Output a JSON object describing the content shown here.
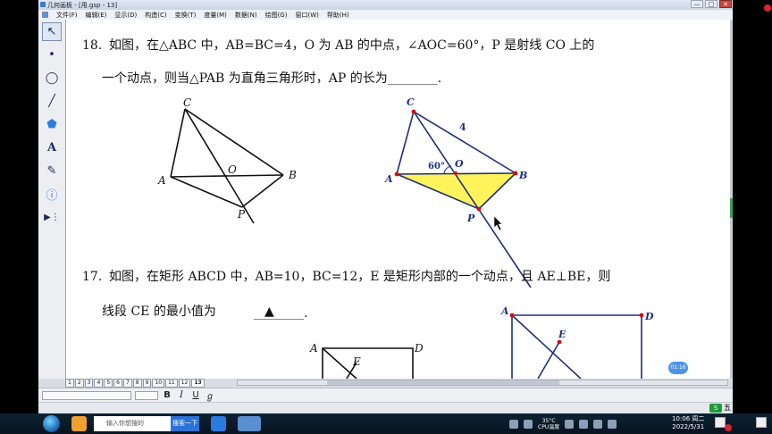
{
  "window": {
    "title": "几何画板 - [用.gsp - 13]",
    "min": "—",
    "max": "□",
    "close": "✕"
  },
  "menu": [
    "文件(F)",
    "编辑(E)",
    "显示(D)",
    "构造(C)",
    "变换(T)",
    "度量(M)",
    "数据(N)",
    "绘图(G)",
    "窗口(W)",
    "帮助(H)"
  ],
  "tools": [
    {
      "name": "select-arrow",
      "glyph": "↖"
    },
    {
      "name": "point",
      "glyph": "•"
    },
    {
      "name": "compass",
      "glyph": "◯"
    },
    {
      "name": "straightedge",
      "glyph": "╱"
    },
    {
      "name": "polygon",
      "glyph": "⬟"
    },
    {
      "name": "text",
      "glyph": "A"
    },
    {
      "name": "marker",
      "glyph": "✎"
    },
    {
      "name": "information",
      "glyph": "ⓘ"
    },
    {
      "name": "custom",
      "glyph": "▶⋮"
    }
  ],
  "q18": {
    "number": "18.",
    "line1": "如图，在△ABC 中，AB=BC=4，O 为 AB 的中点，∠AOC=60°，P 是射线 CO 上的",
    "line2": "一个动点，则当△PAB 为直角三角形时，AP 的长为________.",
    "labels_left": {
      "C": "C",
      "A": "A",
      "B": "B",
      "O": "O",
      "P": "P"
    },
    "labels_right": {
      "C": "C",
      "A": "A",
      "B": "B",
      "O": "O",
      "P": "P",
      "side": "4",
      "angle": "60°"
    }
  },
  "q17": {
    "number": "17.",
    "line1": "如图，在矩形 ABCD 中，AB=10，BC=12，E 是矩形内部的一个动点，且 AE⊥BE，则",
    "line2": "线段 CE 的最小值为",
    "answer": "▲",
    "tail": "________.",
    "labels_left": {
      "A": "A",
      "D": "D",
      "E": "E"
    },
    "labels_right": {
      "A": "A",
      "D": "D",
      "E": "E"
    }
  },
  "page_tabs": [
    "1",
    "2",
    "3",
    "4",
    "5",
    "6",
    "7",
    "8",
    "9",
    "10",
    "11",
    "12",
    "13"
  ],
  "active_tab": "13",
  "format": {
    "bold": "B",
    "italic": "I",
    "underline": "U",
    "special": "ℊ"
  },
  "timer": "01:16",
  "ime": "五",
  "taskbar": {
    "search_placeholder": "输入你想搜的",
    "search_button": "搜索一下",
    "temp": "35°C",
    "temp_label": "CPU温度",
    "time": "10:06 周二",
    "date": "2022/5/31"
  },
  "colors": {
    "accent": "#1f2f7a",
    "fill": "#fff35c",
    "point": "#cc1111"
  }
}
